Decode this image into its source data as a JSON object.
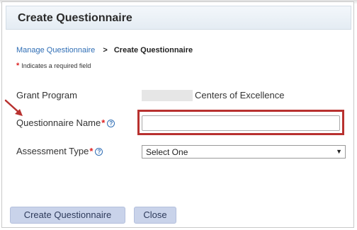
{
  "header": {
    "title": "Create Questionnaire"
  },
  "breadcrumb": {
    "link": "Manage Questionnaire",
    "separator": ">",
    "current": "Create Questionnaire"
  },
  "required_note": {
    "star": "*",
    "text": "Indicates a required field"
  },
  "form": {
    "grant_program": {
      "label": "Grant Program",
      "value": "Centers of Excellence"
    },
    "questionnaire_name": {
      "label": "Questionnaire Name",
      "required_mark": "*",
      "value": ""
    },
    "assessment_type": {
      "label": "Assessment Type",
      "required_mark": "*",
      "selected": "Select One"
    }
  },
  "help_icon_glyph": "?",
  "buttons": {
    "create": "Create Questionnaire",
    "close": "Close"
  },
  "colors": {
    "link": "#2f6eb5",
    "required": "#dd2222",
    "highlight": "#b8312f",
    "button_bg": "#c9d3ea"
  }
}
